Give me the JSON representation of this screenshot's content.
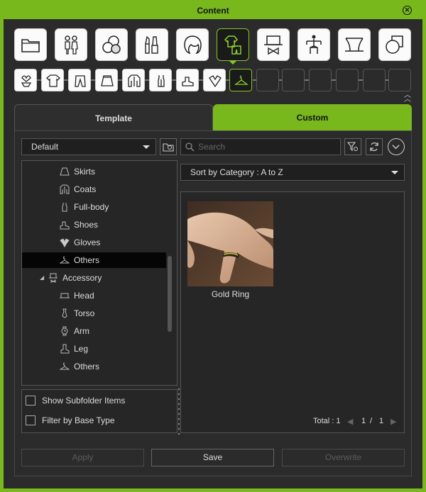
{
  "window": {
    "title": "Content"
  },
  "category_icons": [
    {
      "name": "folder-icon"
    },
    {
      "name": "actor-icon"
    },
    {
      "name": "material-balls-icon"
    },
    {
      "name": "makeup-icon"
    },
    {
      "name": "hair-icon"
    },
    {
      "name": "clothing-icon",
      "active": true
    },
    {
      "name": "accessory-icon"
    },
    {
      "name": "bone-icon"
    },
    {
      "name": "stage-icon"
    },
    {
      "name": "shapes-icon"
    }
  ],
  "sub_icons": [
    {
      "name": "underwear-icon"
    },
    {
      "name": "shirt-icon"
    },
    {
      "name": "pants-icon"
    },
    {
      "name": "skirt-icon"
    },
    {
      "name": "coat-icon"
    },
    {
      "name": "fullbody-icon"
    },
    {
      "name": "shoe-icon"
    },
    {
      "name": "gloves-icon"
    },
    {
      "name": "hanger-icon",
      "active": true
    }
  ],
  "tabs": {
    "template": "Template",
    "custom": "Custom"
  },
  "folder_select": {
    "value": "Default"
  },
  "search": {
    "placeholder": "Search"
  },
  "sort": {
    "value": "Sort by Category : A to Z"
  },
  "tree": [
    {
      "label": "Skirts",
      "icon": "skirt-icon",
      "level": 2
    },
    {
      "label": "Coats",
      "icon": "coat-icon",
      "level": 2
    },
    {
      "label": "Full-body",
      "icon": "fullbody-icon",
      "level": 2
    },
    {
      "label": "Shoes",
      "icon": "shoe-icon",
      "level": 2
    },
    {
      "label": "Gloves",
      "icon": "gloves-icon",
      "level": 2
    },
    {
      "label": "Others",
      "icon": "hanger-icon",
      "level": 2,
      "selected": true
    },
    {
      "label": "Accessory",
      "icon": "accessory-icon",
      "level": 1,
      "expanded": true
    },
    {
      "label": "Head",
      "icon": "head-accessory-icon",
      "level": 2
    },
    {
      "label": "Torso",
      "icon": "tie-icon",
      "level": 2
    },
    {
      "label": "Arm",
      "icon": "watch-icon",
      "level": 2
    },
    {
      "label": "Leg",
      "icon": "leg-icon",
      "level": 2
    },
    {
      "label": "Others",
      "icon": "hanger-icon",
      "level": 2
    }
  ],
  "options": {
    "show_subfolder": "Show Subfolder Items",
    "filter_base": "Filter by Base Type"
  },
  "items": [
    {
      "label": "Gold Ring"
    }
  ],
  "pager": {
    "total_label": "Total : 1",
    "current": "1",
    "sep": "/",
    "pages": "1"
  },
  "buttons": {
    "apply": "Apply",
    "save": "Save",
    "overwrite": "Overwrite"
  },
  "colors": {
    "accent": "#78b81d",
    "background": "#2b2b2b"
  }
}
